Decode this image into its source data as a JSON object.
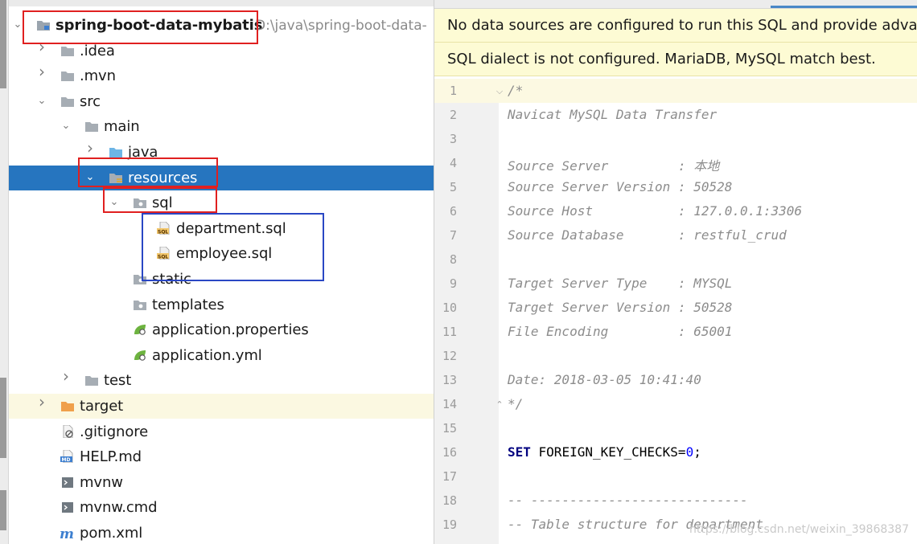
{
  "project_tree": [
    {
      "label": "spring-boot-data-mybatis",
      "path": "D:\\java\\spring-boot-data-",
      "icon": "module-folder-icon",
      "arrow": "expanded",
      "bold": true
    },
    {
      "label": ".idea",
      "icon": "folder-icon",
      "arrow": "collapsed"
    },
    {
      "label": ".mvn",
      "icon": "folder-icon",
      "arrow": "collapsed"
    },
    {
      "label": "src",
      "icon": "folder-icon",
      "arrow": "expanded"
    },
    {
      "label": "main",
      "icon": "folder-icon",
      "arrow": "expanded"
    },
    {
      "label": "java",
      "icon": "source-folder-icon",
      "arrow": "collapsed"
    },
    {
      "label": "resources",
      "icon": "resources-folder-icon",
      "arrow": "expanded",
      "selected": true
    },
    {
      "label": "sql",
      "icon": "package-folder-icon",
      "arrow": "expanded"
    },
    {
      "label": "department.sql",
      "icon": "sql-file-icon"
    },
    {
      "label": "employee.sql",
      "icon": "sql-file-icon"
    },
    {
      "label": "static",
      "icon": "package-folder-icon"
    },
    {
      "label": "templates",
      "icon": "package-folder-icon"
    },
    {
      "label": "application.properties",
      "icon": "spring-config-icon"
    },
    {
      "label": "application.yml",
      "icon": "spring-config-icon"
    },
    {
      "label": "test",
      "icon": "folder-icon",
      "arrow": "collapsed"
    },
    {
      "label": "target",
      "icon": "excluded-folder-icon",
      "arrow": "collapsed",
      "highlight": true
    },
    {
      "label": ".gitignore",
      "icon": "gitignore-file-icon"
    },
    {
      "label": "HELP.md",
      "icon": "markdown-file-icon"
    },
    {
      "label": "mvnw",
      "icon": "script-file-icon"
    },
    {
      "label": "mvnw.cmd",
      "icon": "script-file-icon"
    },
    {
      "label": "pom.xml",
      "icon": "maven-pom-icon"
    }
  ],
  "editor": {
    "notices": [
      "No data sources are configured to run this SQL and provide advance",
      "SQL dialect is not configured. MariaDB, MySQL match best."
    ],
    "lines": [
      {
        "n": "1",
        "text": "/*",
        "type": "comment"
      },
      {
        "n": "2",
        "text": "Navicat MySQL Data Transfer",
        "type": "comment"
      },
      {
        "n": "3",
        "text": "",
        "type": "comment"
      },
      {
        "n": "4",
        "text": "Source Server         : 本地",
        "type": "comment"
      },
      {
        "n": "5",
        "text": "Source Server Version : 50528",
        "type": "comment"
      },
      {
        "n": "6",
        "text": "Source Host           : 127.0.0.1:3306",
        "type": "comment"
      },
      {
        "n": "7",
        "text": "Source Database       : restful_crud",
        "type": "comment"
      },
      {
        "n": "8",
        "text": "",
        "type": "comment"
      },
      {
        "n": "9",
        "text": "Target Server Type    : MYSQL",
        "type": "comment"
      },
      {
        "n": "10",
        "text": "Target Server Version : 50528",
        "type": "comment"
      },
      {
        "n": "11",
        "text": "File Encoding         : 65001",
        "type": "comment"
      },
      {
        "n": "12",
        "text": "",
        "type": "comment"
      },
      {
        "n": "13",
        "text": "Date: 2018-03-05 10:41:40",
        "type": "comment"
      },
      {
        "n": "14",
        "text": "*/",
        "type": "comment"
      },
      {
        "n": "15",
        "text": "",
        "type": "plain"
      },
      {
        "n": "16",
        "text": "",
        "type": "sql",
        "keyword": "SET",
        "rest": " FOREIGN_KEY_CHECKS=",
        "number": "0",
        "tail": ";"
      },
      {
        "n": "17",
        "text": "",
        "type": "plain"
      },
      {
        "n": "18",
        "text": "-- ----------------------------",
        "type": "comment"
      },
      {
        "n": "19",
        "text": "-- Table structure for department",
        "type": "comment"
      }
    ]
  },
  "watermark": "https://blog.csdn.net/weixin_39868387",
  "colors": {
    "selection": "#2675bf",
    "annotation_red": "#e02020",
    "annotation_blue": "#2a47c4",
    "notice_bg": "#fdfbd4",
    "comment": "#8c8c8c",
    "keyword": "#000080",
    "number": "#0000ff"
  }
}
